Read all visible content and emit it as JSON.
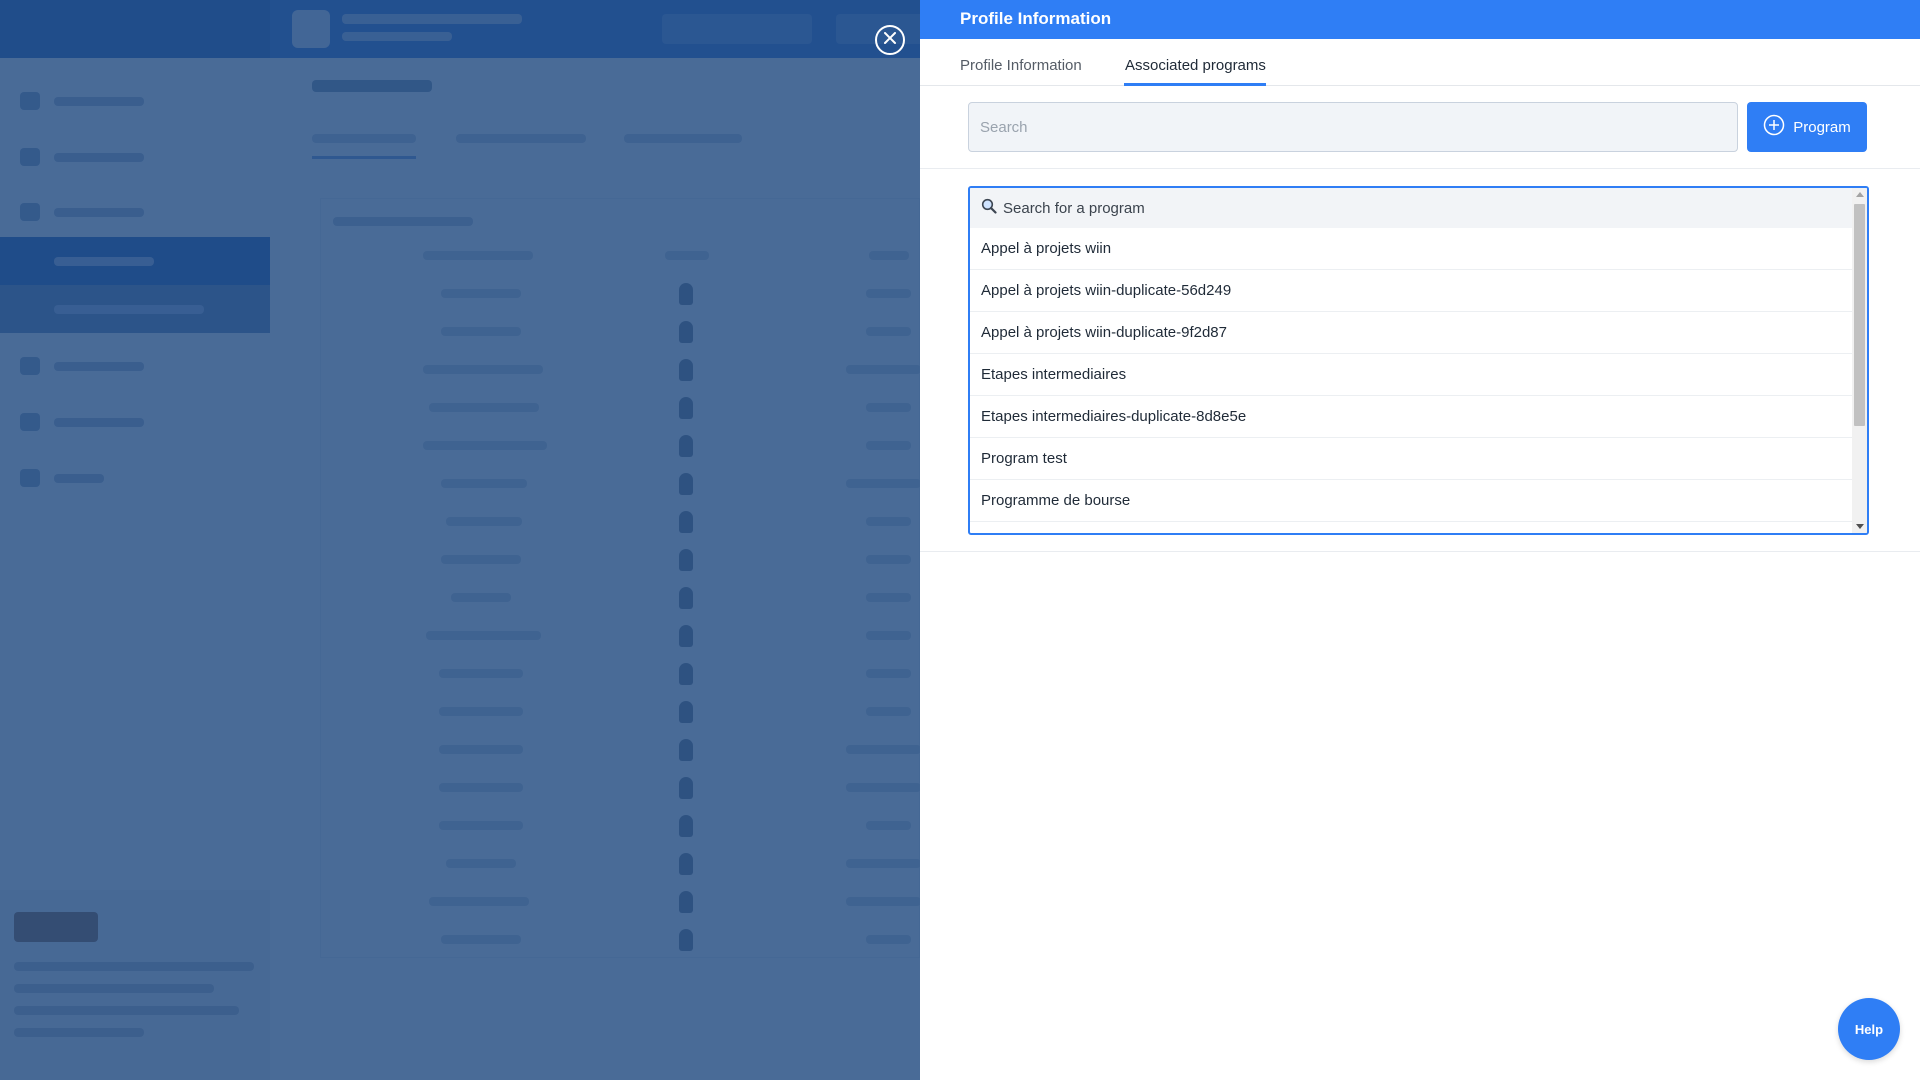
{
  "drawer": {
    "title": "Profile Information",
    "tabs": [
      {
        "label": "Profile Information",
        "active": false
      },
      {
        "label": "Associated programs",
        "active": true
      }
    ],
    "search": {
      "placeholder": "Search",
      "value": ""
    },
    "add_button_label": "Program"
  },
  "dropdown": {
    "search_label": "Search for a program",
    "items": [
      "Appel à projets wiin",
      "Appel à projets wiin-duplicate-56d249",
      "Appel à projets wiin-duplicate-9f2d87",
      "Etapes intermediaires",
      "Etapes intermediaires-duplicate-8d8e5e",
      "Program test",
      "Programme de bourse"
    ]
  },
  "help": {
    "label": "Help"
  },
  "icons": {
    "close": "close-icon",
    "add": "plus-circle-icon",
    "search": "search-icon"
  },
  "colors": {
    "primary": "#2f7ef5",
    "overlay": "#214a80",
    "text": "#1f2a37"
  }
}
